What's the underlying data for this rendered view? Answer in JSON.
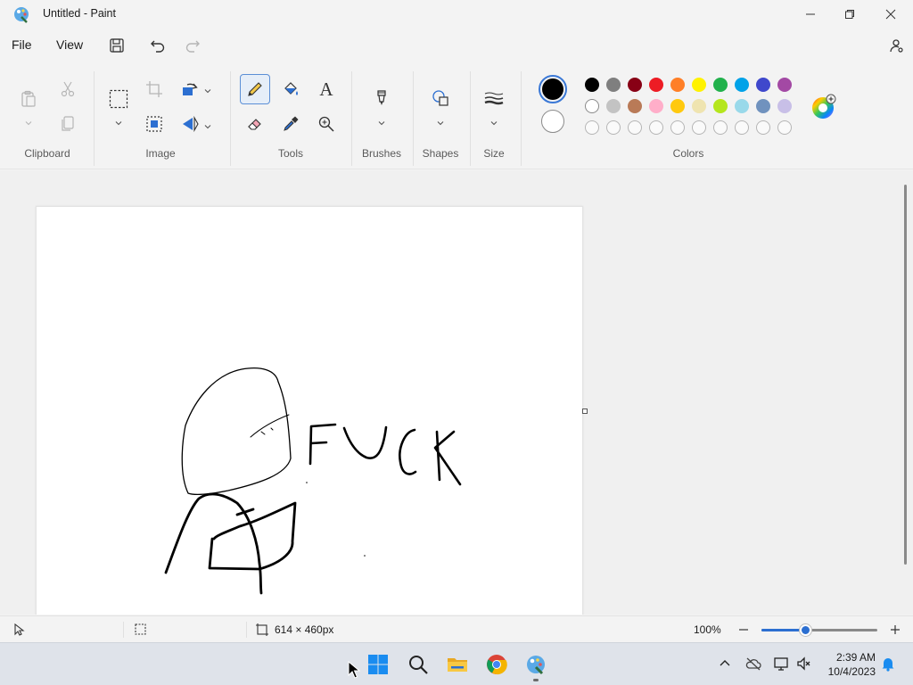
{
  "window": {
    "title": "Untitled - Paint",
    "app_icon": "paint-palette-icon"
  },
  "menu": {
    "file": "File",
    "view": "View"
  },
  "ribbon": {
    "groups": {
      "clipboard": "Clipboard",
      "image": "Image",
      "tools": "Tools",
      "brushes": "Brushes",
      "shapes": "Shapes",
      "size": "Size",
      "colors": "Colors"
    },
    "text_tool_glyph": "A",
    "selected_tool": "pencil"
  },
  "colors": {
    "primary": "#000000",
    "secondary": "#ffffff",
    "palette_row1": [
      "#000000",
      "#7f7f7f",
      "#880015",
      "#ed1c24",
      "#ff7f27",
      "#fff200",
      "#22b14c",
      "#00a2e8",
      "#3f48cc",
      "#a349a4"
    ],
    "palette_row2": [
      "#ffffff",
      "#c3c3c3",
      "#b97a57",
      "#ffaec9",
      "#ffc90e",
      "#efe4b0",
      "#b5e61d",
      "#99d9ea",
      "#7092be",
      "#c8bfe7"
    ],
    "palette_row3_empty_count": 10,
    "accent": "#2c6fd1"
  },
  "status": {
    "canvas_size": "614 × 460px",
    "zoom": "100%",
    "zoom_fraction": 0.38
  },
  "taskbar": {
    "time": "2:39 AM",
    "date": "10/4/2023",
    "apps": [
      "start-icon",
      "search-icon",
      "file-explorer-icon",
      "chrome-icon",
      "paint-icon"
    ]
  }
}
